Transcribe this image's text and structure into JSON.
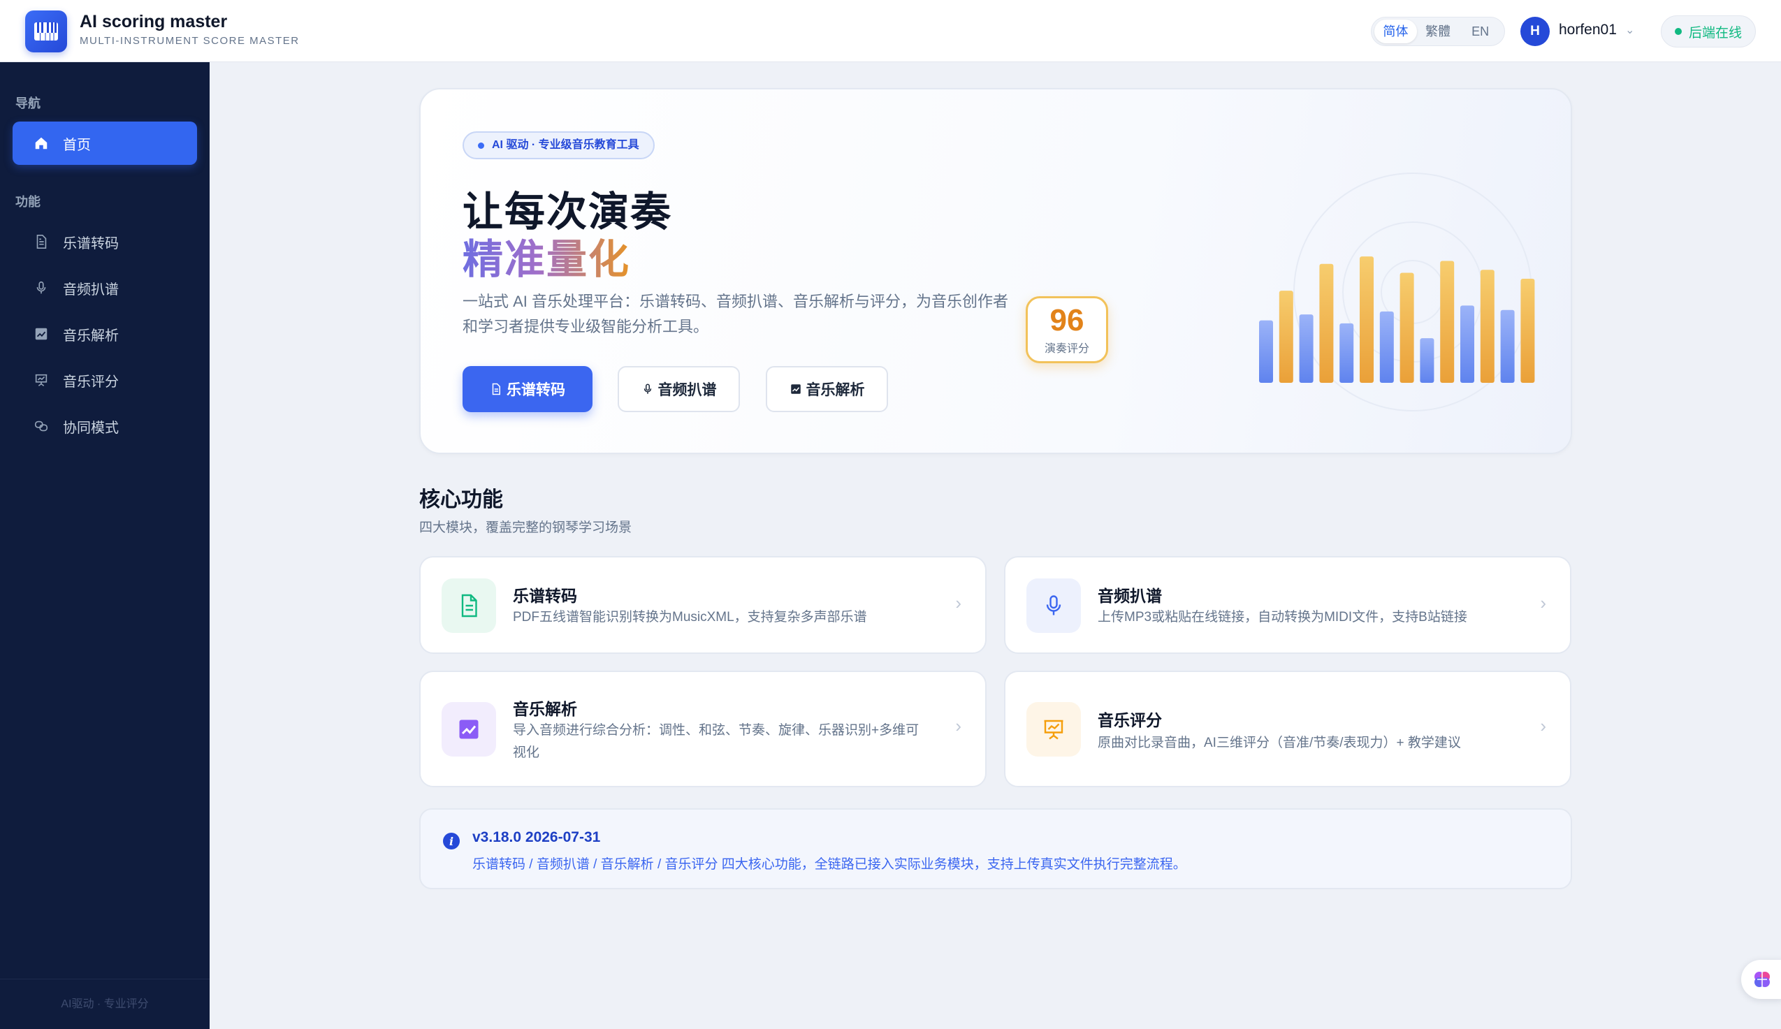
{
  "header": {
    "app_title": "AI scoring master",
    "app_subtitle": "MULTI-INSTRUMENT SCORE MASTER",
    "languages": [
      "简体",
      "繁體",
      "EN"
    ],
    "active_language": "简体",
    "user_initial": "H",
    "username": "horfen01",
    "status": "后端在线"
  },
  "sidebar": {
    "nav_section": "导航",
    "func_section": "功能",
    "items": [
      {
        "label": "首页",
        "icon": "home-icon",
        "active": true
      },
      {
        "label": "乐谱转码",
        "icon": "document-icon"
      },
      {
        "label": "音频扒谱",
        "icon": "microphone-icon"
      },
      {
        "label": "音乐解析",
        "icon": "chart-icon"
      },
      {
        "label": "音乐评分",
        "icon": "presentation-icon"
      },
      {
        "label": "协同模式",
        "icon": "link-icon"
      }
    ],
    "footer": "AI驱动 · 专业评分"
  },
  "hero": {
    "badge": "AI 驱动 · 专业级音乐教育工具",
    "title_line1": "让每次演奏",
    "title_line2": "精准量化",
    "description": "一站式 AI 音乐处理平台：乐谱转码、音频扒谱、音乐解析与评分，为音乐创作者和学习者提供专业级智能分析工具。",
    "buttons": [
      "乐谱转码",
      "音频扒谱",
      "音乐解析"
    ],
    "score_value": "96",
    "score_label": "演奏评分",
    "bar_levels": [
      {
        "color": "blue",
        "v": 0.42
      },
      {
        "color": "orange",
        "v": 0.62
      },
      {
        "color": "blue",
        "v": 0.46
      },
      {
        "color": "orange",
        "v": 0.8
      },
      {
        "color": "blue",
        "v": 0.4
      },
      {
        "color": "orange",
        "v": 0.85
      },
      {
        "color": "blue",
        "v": 0.48
      },
      {
        "color": "orange",
        "v": 0.74
      },
      {
        "color": "blue",
        "v": 0.3
      },
      {
        "color": "orange",
        "v": 0.82
      },
      {
        "color": "blue",
        "v": 0.52
      },
      {
        "color": "orange",
        "v": 0.76
      },
      {
        "color": "blue",
        "v": 0.49
      },
      {
        "color": "orange",
        "v": 0.7
      }
    ],
    "colors": {
      "blue": "#7d9cf4",
      "orange": "#f2b04a",
      "accent": "#3b66f0"
    }
  },
  "features": {
    "title": "核心功能",
    "subtitle": "四大模块，覆盖完整的钢琴学习场景",
    "cards": [
      {
        "title": "乐谱转码",
        "desc": "PDF五线谱智能识别转换为MusicXML，支持复杂多声部乐谱",
        "icon": "document-icon",
        "color": "#10b981",
        "bg": "#e9f8f1"
      },
      {
        "title": "音频扒谱",
        "desc": "上传MP3或粘贴在线链接，自动转换为MIDI文件，支持B站链接",
        "icon": "microphone-icon",
        "color": "#3b66f0",
        "bg": "#edf1fd"
      },
      {
        "title": "音乐解析",
        "desc": "导入音频进行综合分析：调性、和弦、节奏、旋律、乐器识别+多维可视化",
        "icon": "trend-chart-icon",
        "color": "#8b5cf6",
        "bg": "#f2edfd"
      },
      {
        "title": "音乐评分",
        "desc": "原曲对比录音曲，AI三维评分（音准/节奏/表现力）+ 教学建议",
        "icon": "presentation-icon",
        "color": "#f59e0b",
        "bg": "#fef5e7"
      }
    ]
  },
  "version": {
    "title": "v3.18.0 2026-07-31",
    "desc": "乐谱转码 / 音频扒谱 / 音乐解析 / 音乐评分 四大核心功能，全链路已接入实际业务模块，支持上传真实文件执行完整流程。"
  }
}
